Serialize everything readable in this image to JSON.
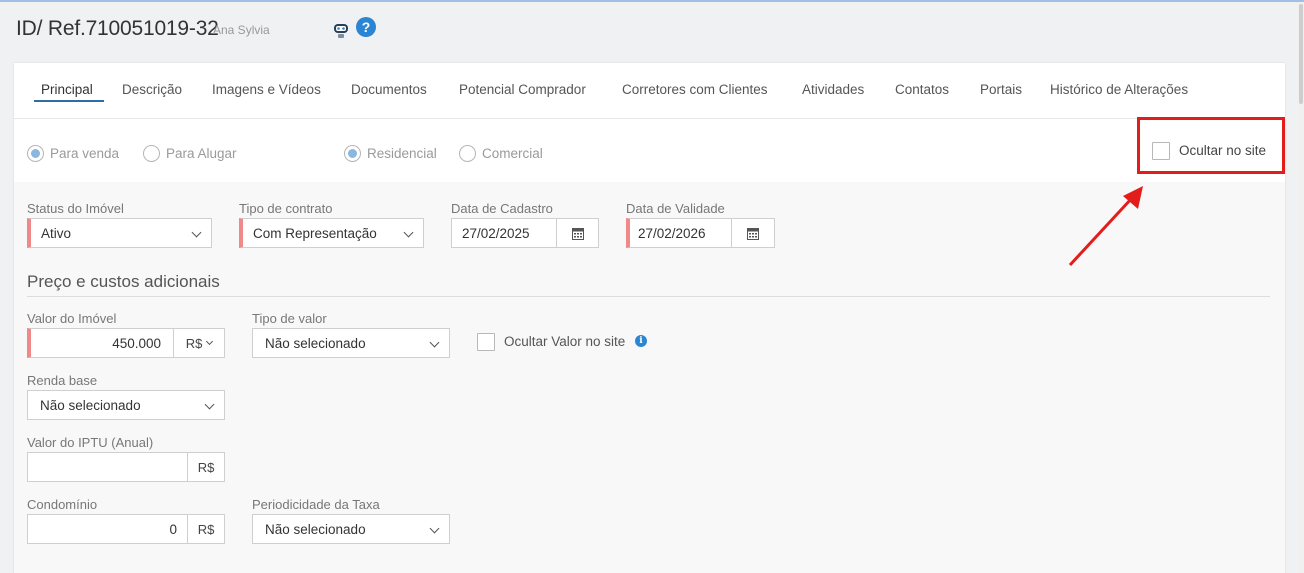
{
  "header": {
    "title": "ID/ Ref.710051019-32",
    "subtitle": "Ana Sylvia"
  },
  "tabs": [
    {
      "label": "Principal",
      "active": true
    },
    {
      "label": "Descrição"
    },
    {
      "label": "Imagens e Vídeos"
    },
    {
      "label": "Documentos"
    },
    {
      "label": "Potencial Comprador"
    },
    {
      "label": "Corretores com Clientes"
    },
    {
      "label": "Atividades"
    },
    {
      "label": "Contatos"
    },
    {
      "label": "Portais"
    },
    {
      "label": "Histórico de Alterações"
    }
  ],
  "radios": {
    "venda": {
      "label": "Para venda",
      "checked": true
    },
    "alugar": {
      "label": "Para Alugar",
      "checked": false
    },
    "residencial": {
      "label": "Residencial",
      "checked": true
    },
    "comercial": {
      "label": "Comercial",
      "checked": false
    }
  },
  "ocultar_site": {
    "label": "Ocultar no site",
    "checked": false
  },
  "status": {
    "label": "Status do Imóvel",
    "value": "Ativo"
  },
  "contrato": {
    "label": "Tipo de contrato",
    "value": "Com Representação"
  },
  "cadastro": {
    "label": "Data de Cadastro",
    "value": "27/02/2025"
  },
  "validade": {
    "label": "Data de Validade",
    "value": "27/02/2026"
  },
  "section": {
    "title": "Preço e custos adicionais"
  },
  "valor_imovel": {
    "label": "Valor do Imóvel",
    "value": "450.000",
    "currency": "R$"
  },
  "tipo_valor": {
    "label": "Tipo de valor",
    "value": "Não selecionado"
  },
  "ocultar_valor": {
    "label": "Ocultar Valor no site",
    "checked": false,
    "info": "i"
  },
  "renda_base": {
    "label": "Renda base",
    "value": "Não selecionado"
  },
  "iptu": {
    "label": "Valor do IPTU (Anual)",
    "value": "",
    "currency": "R$"
  },
  "condominio": {
    "label": "Condomínio",
    "value": "0",
    "currency": "R$"
  },
  "periodicidade": {
    "label": "Periodicidade da Taxa",
    "value": "Não selecionado"
  },
  "help": "?",
  "colors": {
    "accent": "#2d6ea6",
    "required": "#f08a8a",
    "highlight": "#e31c1c",
    "info": "#2a86d3"
  }
}
